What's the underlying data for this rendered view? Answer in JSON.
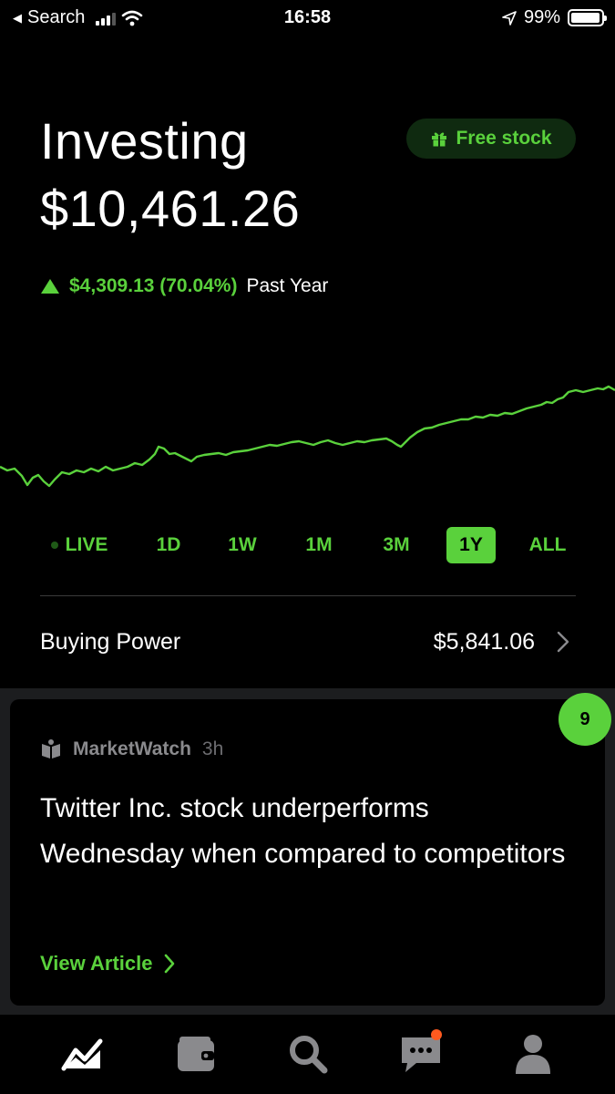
{
  "status_bar": {
    "back_label": "Search",
    "time": "16:58",
    "battery": "99%",
    "icons": [
      "back-arrow-icon",
      "cellular-signal-icon",
      "wifi-icon",
      "location-icon",
      "battery-icon"
    ]
  },
  "header": {
    "title": "Investing",
    "balance": "$10,461.26",
    "free_stock_label": "Free stock",
    "change_value": "$4,309.13 (70.04%)",
    "change_period": "Past Year",
    "change_direction": "up"
  },
  "colors": {
    "accent": "#5ad13c",
    "background": "#000000",
    "card_band": "#1c1d1f",
    "notification": "#ff5a1f"
  },
  "ranges": {
    "live": "LIVE",
    "d1": "1D",
    "w1": "1W",
    "m1": "1M",
    "m3": "3M",
    "y1": "1Y",
    "all": "ALL",
    "active": "1Y"
  },
  "buying_power": {
    "label": "Buying Power",
    "value": "$5,841.06"
  },
  "news": {
    "badge_count": "9",
    "source": "MarketWatch",
    "age": "3h",
    "headline": "Twitter Inc. stock underperforms Wednesday when compared to competitors",
    "cta": "View Article"
  },
  "tab_bar": {
    "items": [
      "home-chart-icon",
      "wallet-icon",
      "search-icon",
      "messages-icon",
      "account-icon"
    ],
    "active": "home-chart-icon",
    "messages_has_notification": true
  }
}
